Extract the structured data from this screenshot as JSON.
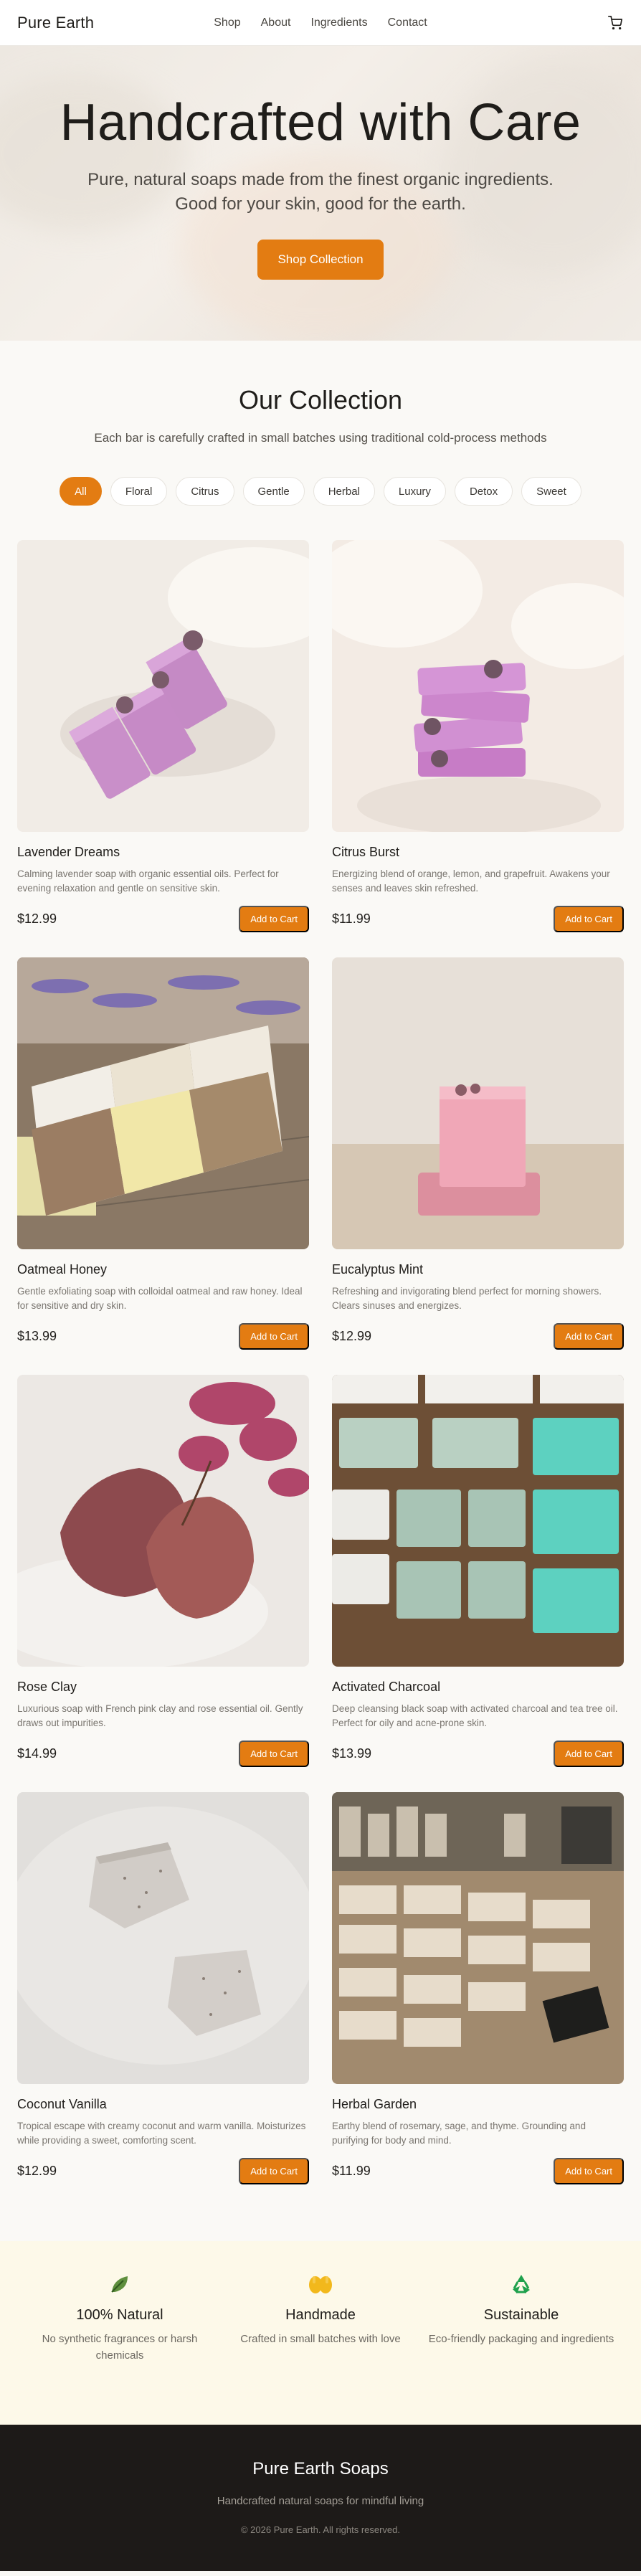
{
  "nav": {
    "brand": "Pure Earth",
    "links": [
      "Shop",
      "About",
      "Ingredients",
      "Contact"
    ],
    "cart_icon": "shopping-cart-icon"
  },
  "hero": {
    "title": "Handcrafted with Care",
    "subtitle_line1": "Pure, natural soaps made from the finest organic ingredients.",
    "subtitle_line2": "Good for your skin, good for the earth.",
    "cta": "Shop Collection"
  },
  "collection": {
    "title": "Our Collection",
    "subtitle": "Each bar is carefully crafted in small batches using traditional cold-process methods",
    "filters": [
      "All",
      "Floral",
      "Citrus",
      "Gentle",
      "Herbal",
      "Luxury",
      "Detox",
      "Sweet"
    ],
    "active_filter": "All",
    "add_label": "Add to Cart",
    "products": [
      {
        "name": "Lavender Dreams",
        "desc": "Calming lavender soap with organic essential oils. Perfect for evening relaxation and gentle on sensitive skin.",
        "price": "$12.99"
      },
      {
        "name": "Citrus Burst",
        "desc": "Energizing blend of orange, lemon, and grapefruit. Awakens your senses and leaves skin refreshed.",
        "price": "$11.99"
      },
      {
        "name": "Oatmeal Honey",
        "desc": "Gentle exfoliating soap with colloidal oatmeal and raw honey. Ideal for sensitive and dry skin.",
        "price": "$13.99"
      },
      {
        "name": "Eucalyptus Mint",
        "desc": "Refreshing and invigorating blend perfect for morning showers. Clears sinuses and energizes.",
        "price": "$12.99"
      },
      {
        "name": "Rose Clay",
        "desc": "Luxurious soap with French pink clay and rose essential oil. Gently draws out impurities.",
        "price": "$14.99"
      },
      {
        "name": "Activated Charcoal",
        "desc": "Deep cleansing black soap with activated charcoal and tea tree oil. Perfect for oily and acne-prone skin.",
        "price": "$13.99"
      },
      {
        "name": "Coconut Vanilla",
        "desc": "Tropical escape with creamy coconut and warm vanilla. Moisturizes while providing a sweet, comforting scent.",
        "price": "$12.99"
      },
      {
        "name": "Herbal Garden",
        "desc": "Earthy blend of rosemary, sage, and thyme. Grounding and purifying for body and mind.",
        "price": "$11.99"
      }
    ]
  },
  "features": [
    {
      "icon": "leaf-icon",
      "title": "100% Natural",
      "desc": "No synthetic fragrances or harsh chemicals"
    },
    {
      "icon": "hands-icon",
      "title": "Handmade",
      "desc": "Crafted in small batches with love"
    },
    {
      "icon": "recycle-icon",
      "title": "Sustainable",
      "desc": "Eco-friendly packaging and ingredients"
    }
  ],
  "footer": {
    "title": "Pure Earth Soaps",
    "tagline": "Handcrafted natural soaps for mindful living",
    "copyright": "© 2026 Pure Earth. All rights reserved."
  },
  "colors": {
    "accent": "#e37c12",
    "footer_bg": "#1d1a18",
    "features_bg": "#fdf9e9"
  }
}
